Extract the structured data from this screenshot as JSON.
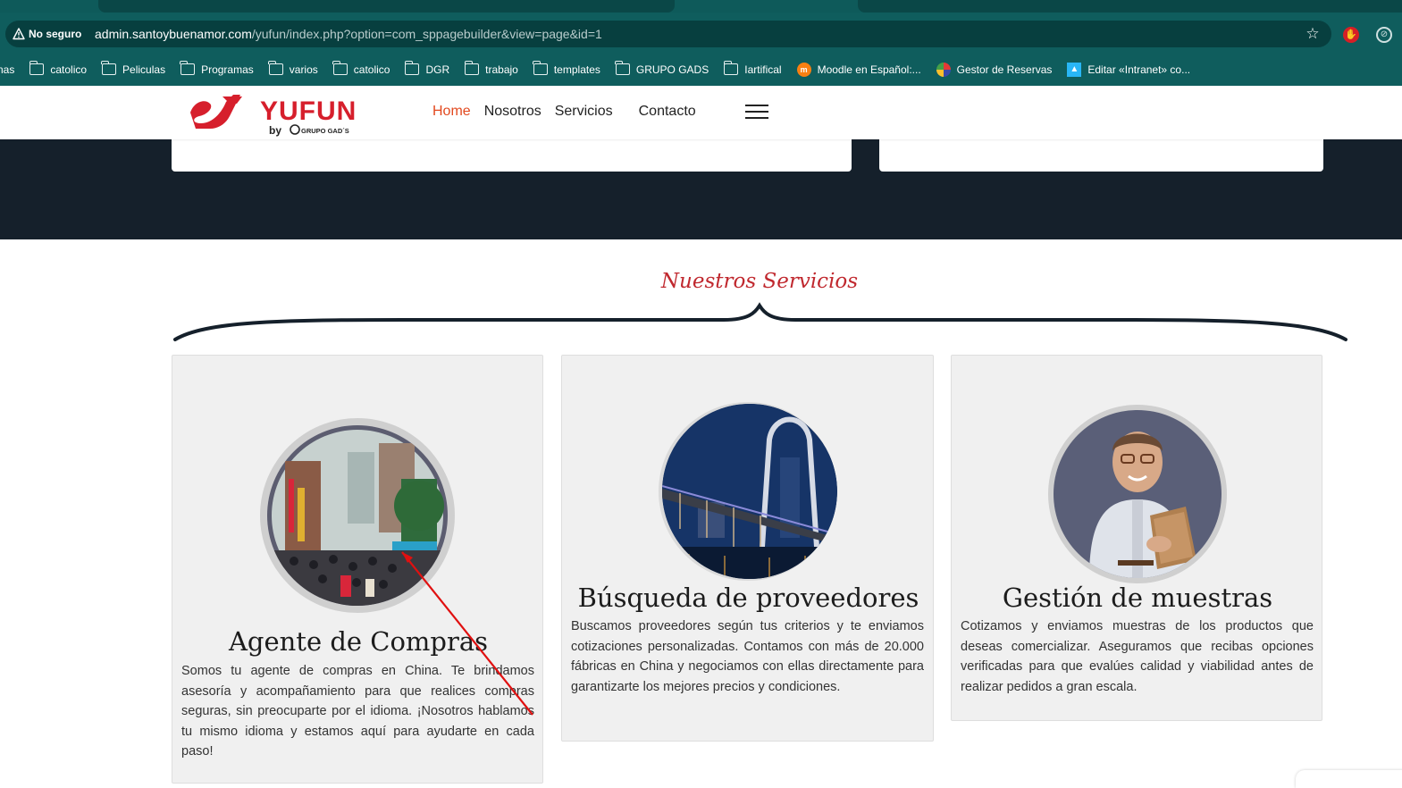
{
  "browser": {
    "security_label": "No seguro",
    "url_host": "admin.santoybuenamor.com",
    "url_path": "/yufun/index.php?option=com_sppagebuilder&view=page&id=1",
    "icons": [
      "warning-icon",
      "star-icon",
      "extension-red-icon",
      "compass-icon"
    ]
  },
  "bookmarks": [
    {
      "label": "nas",
      "icon": "none"
    },
    {
      "label": "catolico",
      "icon": "folder-icon"
    },
    {
      "label": "Peliculas",
      "icon": "folder-icon"
    },
    {
      "label": "Programas",
      "icon": "folder-icon"
    },
    {
      "label": "varios",
      "icon": "folder-icon"
    },
    {
      "label": "catolico",
      "icon": "folder-icon"
    },
    {
      "label": "DGR",
      "icon": "folder-icon"
    },
    {
      "label": "trabajo",
      "icon": "folder-icon"
    },
    {
      "label": "templates",
      "icon": "folder-icon"
    },
    {
      "label": "GRUPO GADS",
      "icon": "folder-icon"
    },
    {
      "label": "Iartifical",
      "icon": "folder-icon"
    },
    {
      "label": "Moodle en Español:...",
      "icon": "moodle-icon"
    },
    {
      "label": "Gestor de Reservas",
      "icon": "gestor-icon"
    },
    {
      "label": "Editar «Intranet» co...",
      "icon": "intranet-icon"
    }
  ],
  "site": {
    "logo_text": "YUFUN",
    "logo_sub": "by",
    "logo_group": "GRUPO GAD´S",
    "nav": [
      "Home",
      "Nosotros",
      "Servicios",
      "Contacto"
    ],
    "brand_color": "#e2491f",
    "dark_band_color": "#15202b"
  },
  "services": {
    "title": "Nuestros Servicios",
    "cards": [
      {
        "title": "Agente de Compras",
        "text": "Somos tu agente de compras en China. Te brindamos asesoría y acompañamiento para que realices compras seguras, sin preocuparte por el idioma. ¡Nosotros hablamos tu mismo idioma y estamos aquí para ayudarte en cada paso!",
        "image": "busy-city-street-photo"
      },
      {
        "title": "Búsqueda de proveedores",
        "text": "Buscamos proveedores según tus criterios y te enviamos cotizaciones personalizadas. Contamos con más de 20.000 fábricas en China y negociamos con ellas directamente para garantizarte los mejores precios y condiciones.",
        "image": "night-bridge-photo"
      },
      {
        "title": "Gestión de muestras",
        "text": "Cotizamos y enviamos muestras de los productos que deseas comercializar. Aseguramos que recibas opciones verificadas para que evalúes calidad y viabilidad antes de realizar pedidos a gran escala.",
        "image": "man-with-folder-photo"
      }
    ]
  }
}
